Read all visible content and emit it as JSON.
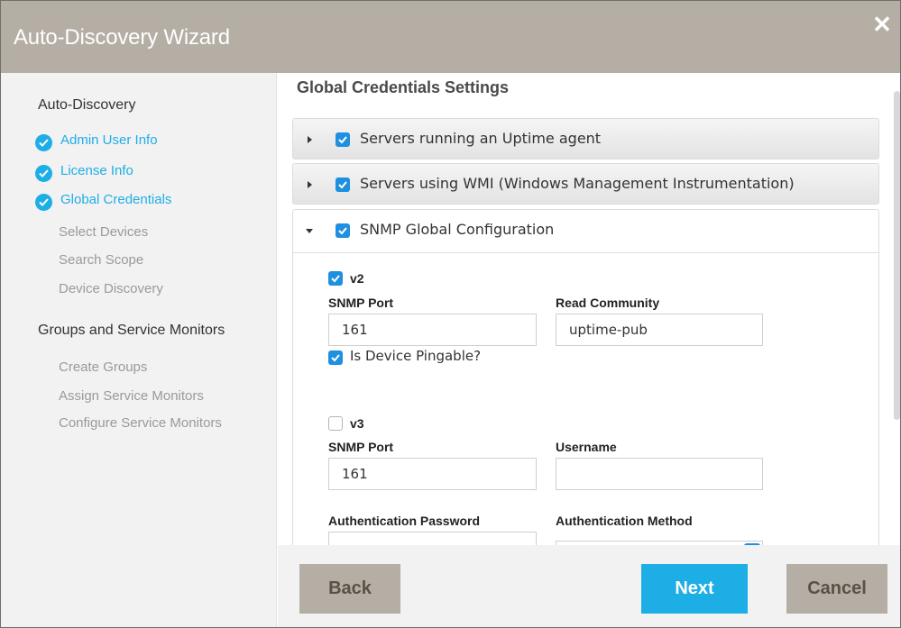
{
  "window": {
    "title": "Auto-Discovery Wizard",
    "close_icon": "close-icon"
  },
  "colors": {
    "titlebar": "#b4aea5",
    "accent": "#1eaee6",
    "checkbox": "#1f8fe0",
    "sidebar_bg": "#f2f2f2"
  },
  "sidebar": {
    "sections": [
      {
        "heading": "Auto-Discovery",
        "steps": [
          {
            "label": "Admin User Info",
            "status": "done"
          },
          {
            "label": "License Info",
            "status": "done"
          },
          {
            "label": "Global Credentials",
            "status": "done"
          },
          {
            "label": "Select Devices",
            "status": "pending"
          },
          {
            "label": "Search Scope",
            "status": "pending"
          },
          {
            "label": "Device Discovery",
            "status": "pending"
          }
        ]
      },
      {
        "heading": "Groups and Service Monitors",
        "steps": [
          {
            "label": "Create Groups",
            "status": "pending"
          },
          {
            "label": "Assign Service Monitors",
            "status": "pending"
          },
          {
            "label": "Configure Service Monitors",
            "status": "pending"
          }
        ]
      }
    ]
  },
  "main": {
    "title": "Global Credentials Settings",
    "panels": [
      {
        "label": "Servers running an Uptime agent",
        "checked": true,
        "expanded": false
      },
      {
        "label": "Servers using WMI (Windows Management Instrumentation)",
        "checked": true,
        "expanded": false
      },
      {
        "label": "SNMP Global Configuration",
        "checked": true,
        "expanded": true
      }
    ],
    "snmp": {
      "v2": {
        "label": "v2",
        "checked": true,
        "port_label": "SNMP Port",
        "port_value": "161",
        "community_label": "Read Community",
        "community_value": "uptime-pub",
        "pingable_label": "Is Device Pingable?",
        "pingable_checked": true
      },
      "v3": {
        "label": "v3",
        "checked": false,
        "port_label": "SNMP Port",
        "port_value": "161",
        "username_label": "Username",
        "username_value": "",
        "auth_password_label": "Authentication Password",
        "auth_method_label": "Authentication Method"
      }
    }
  },
  "footer": {
    "back_label": "Back",
    "next_label": "Next",
    "cancel_label": "Cancel"
  }
}
